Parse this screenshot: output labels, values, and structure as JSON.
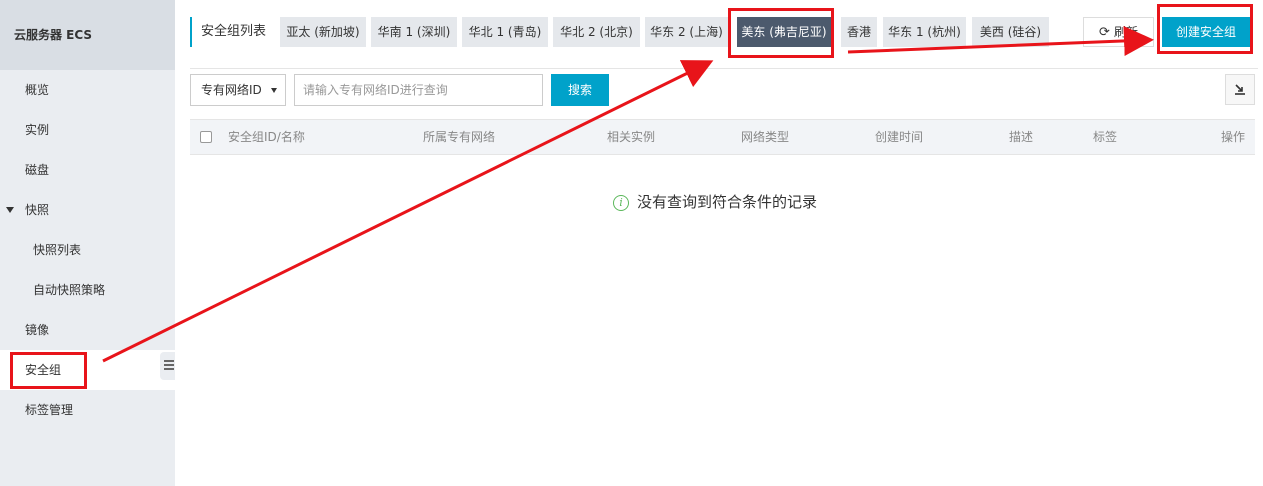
{
  "sidebar": {
    "title": "云服务器 ECS",
    "items": [
      {
        "label": "概览"
      },
      {
        "label": "实例"
      },
      {
        "label": "磁盘"
      },
      {
        "label": "快照"
      },
      {
        "label": "快照列表"
      },
      {
        "label": "自动快照策略"
      },
      {
        "label": "镜像"
      },
      {
        "label": "安全组"
      },
      {
        "label": "标签管理"
      }
    ],
    "active": "安全组"
  },
  "header": {
    "list_title": "安全组列表",
    "region_tabs": [
      {
        "label": "亚太 (新加坡)"
      },
      {
        "label": "华南 1 (深圳)"
      },
      {
        "label": "华北 1 (青岛)"
      },
      {
        "label": "华北 2 (北京)"
      },
      {
        "label": "华东 2 (上海)"
      },
      {
        "label": "美东 (弗吉尼亚)"
      },
      {
        "label": "香港"
      },
      {
        "label": "华东 1 (杭州)"
      },
      {
        "label": "美西 (硅谷)"
      }
    ],
    "active_region": "美东 (弗吉尼亚)",
    "refresh_label": "刷新",
    "create_label": "创建安全组"
  },
  "filter": {
    "select_value": "专有网络ID",
    "search_placeholder": "请输入专有网络ID进行查询",
    "search_label": "搜索"
  },
  "table": {
    "columns": [
      "安全组ID/名称",
      "所属专有网络",
      "相关实例",
      "网络类型",
      "创建时间",
      "描述",
      "标签",
      "操作"
    ],
    "empty_message": "没有查询到符合条件的记录"
  },
  "colors": {
    "accent": "#00a2ca",
    "active_tab": "#4c5a6d",
    "annotation": "#e8141a"
  }
}
